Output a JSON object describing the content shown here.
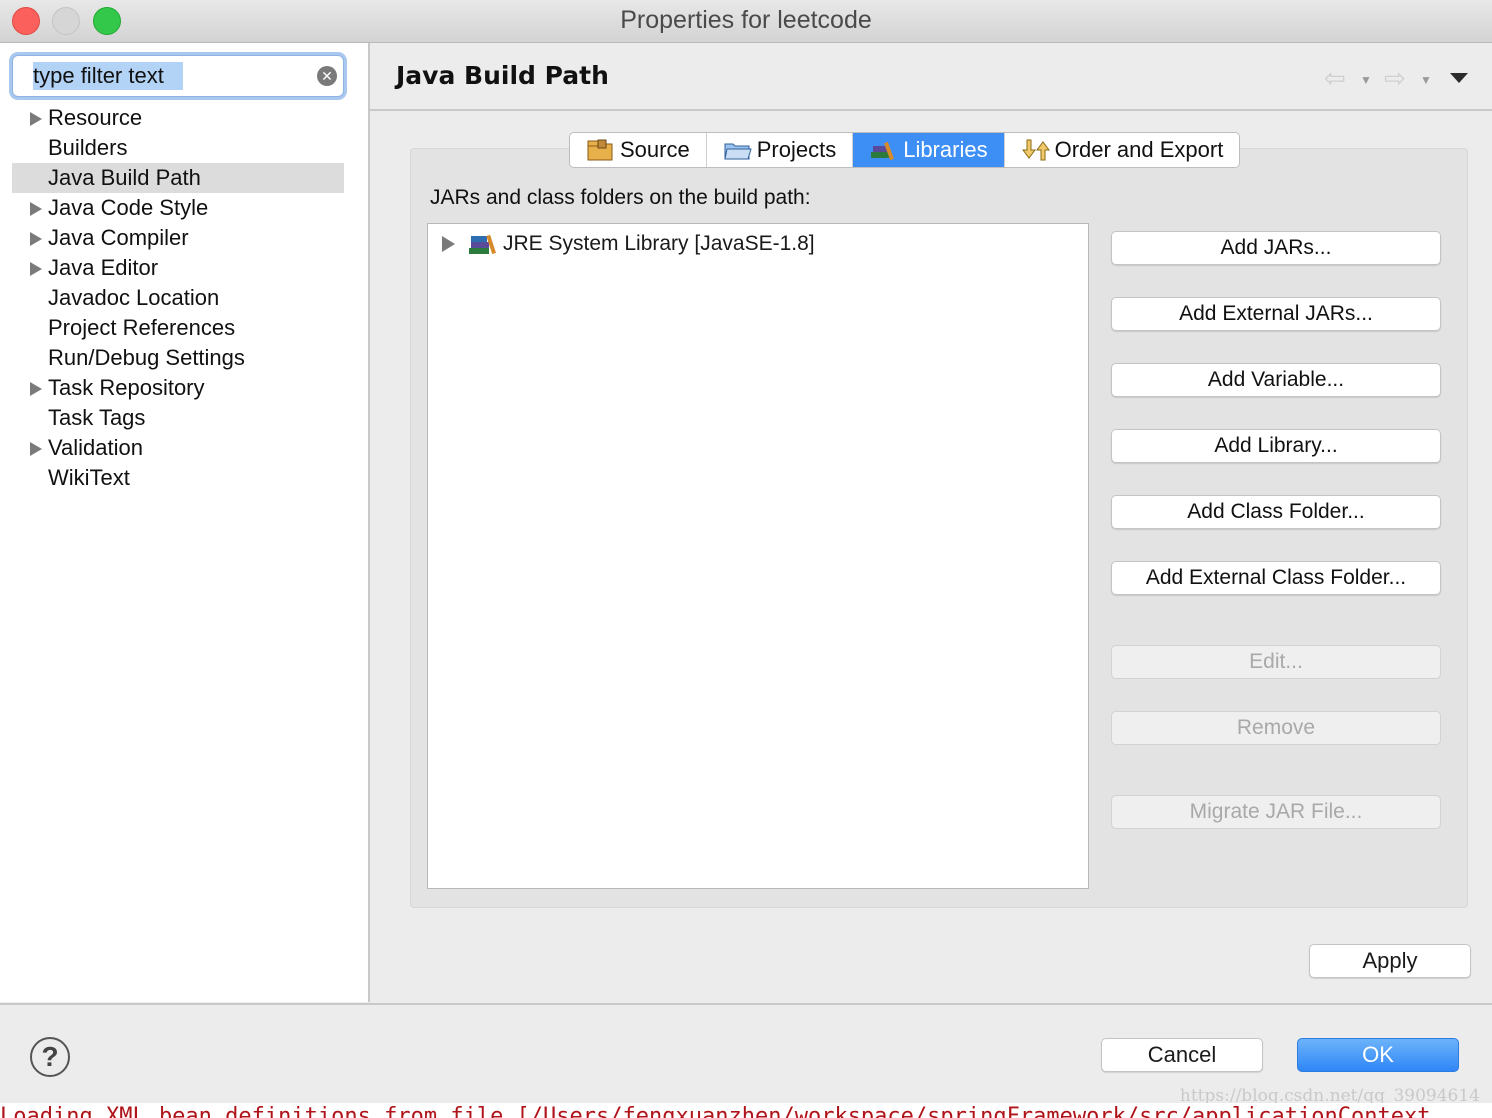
{
  "window": {
    "title": "Properties for leetcode"
  },
  "filter": {
    "value": "type filter text"
  },
  "tree": {
    "items": [
      {
        "label": "Resource",
        "expandable": true
      },
      {
        "label": "Builders",
        "expandable": false
      },
      {
        "label": "Java Build Path",
        "expandable": false,
        "selected": true
      },
      {
        "label": "Java Code Style",
        "expandable": true
      },
      {
        "label": "Java Compiler",
        "expandable": true
      },
      {
        "label": "Java Editor",
        "expandable": true
      },
      {
        "label": "Javadoc Location",
        "expandable": false
      },
      {
        "label": "Project References",
        "expandable": false
      },
      {
        "label": "Run/Debug Settings",
        "expandable": false
      },
      {
        "label": "Task Repository",
        "expandable": true
      },
      {
        "label": "Task Tags",
        "expandable": false
      },
      {
        "label": "Validation",
        "expandable": true
      },
      {
        "label": "WikiText",
        "expandable": false
      }
    ]
  },
  "page": {
    "title": "Java Build Path"
  },
  "tabs": [
    {
      "label": "Source",
      "icon": "source-folder-icon"
    },
    {
      "label": "Projects",
      "icon": "projects-folder-icon"
    },
    {
      "label": "Libraries",
      "icon": "libraries-icon",
      "active": true
    },
    {
      "label": "Order and Export",
      "icon": "order-export-icon"
    }
  ],
  "libraries": {
    "section_label": "JARs and class folders on the build path:",
    "entries": [
      {
        "label": "JRE System Library [JavaSE-1.8]",
        "icon": "library-icon"
      }
    ]
  },
  "buttons": {
    "add_jars": "Add JARs...",
    "add_external_jars": "Add External JARs...",
    "add_variable": "Add Variable...",
    "add_library": "Add Library...",
    "add_class_folder": "Add Class Folder...",
    "add_external_class_folder": "Add External Class Folder...",
    "edit": "Edit...",
    "remove": "Remove",
    "migrate_jar": "Migrate JAR File...",
    "apply": "Apply",
    "cancel": "Cancel",
    "ok": "OK"
  },
  "footer": {
    "watermark": "https://blog.csdn.net/qq_39094614",
    "console_text": "Loading XML bean definitions from file [/Users/fengxuanzhen/workspace/springFramework/src/applicationContext"
  },
  "colors": {
    "accent": "#3d8ff5",
    "ok_button": "#2f86f6",
    "close": "#fc605c",
    "maximize": "#34c84a",
    "console_text": "#b0141a"
  }
}
